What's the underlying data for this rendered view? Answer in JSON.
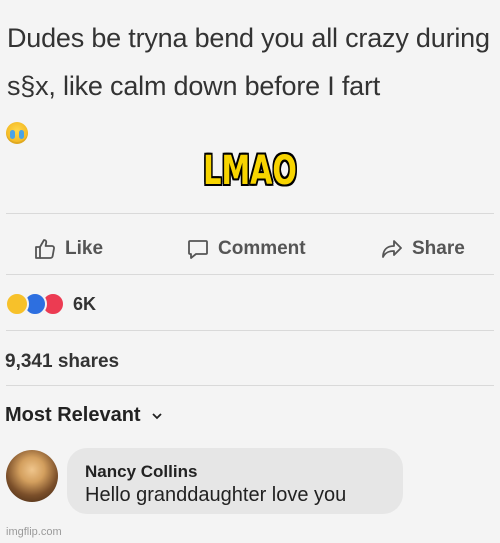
{
  "post": {
    "text": "Dudes be tryna bend you all crazy during s§x, like calm down before I fart",
    "emoji_icon": "crying-laughing-emoji"
  },
  "overlay": {
    "caption": "LMAO",
    "color": "#f7d400"
  },
  "actions": {
    "like_label": "Like",
    "comment_label": "Comment",
    "share_label": "Share"
  },
  "reactions": {
    "icons": [
      "haha-icon",
      "like-icon",
      "love-icon"
    ],
    "count": "6K"
  },
  "shares": {
    "text": "9,341 shares"
  },
  "comments_sort": {
    "label": "Most Relevant"
  },
  "comment": {
    "author": "Nancy Collins",
    "text": "Hello granddaughter love you"
  },
  "watermark": {
    "text": "imgflip.com"
  }
}
